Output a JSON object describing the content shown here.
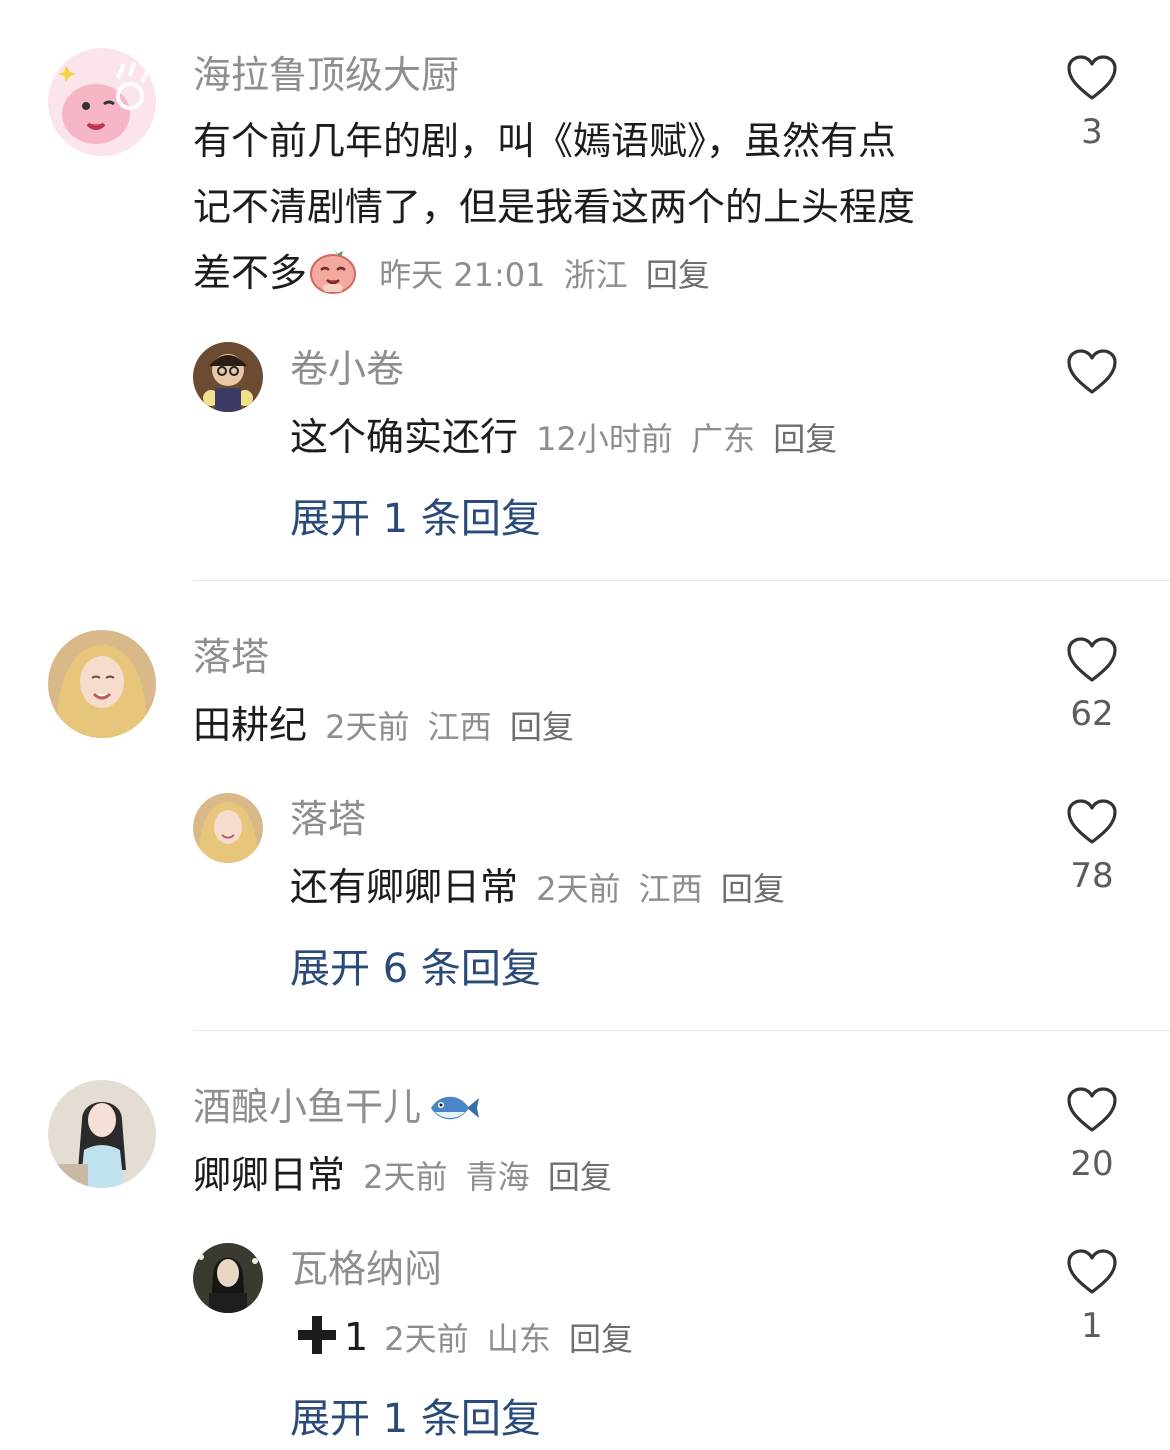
{
  "comments": [
    {
      "user": "海拉鲁顶级大厨",
      "text_line1": "有个前几年的剧，叫《嫣语赋》，虽然有点",
      "text_line2": "记不清剧情了，但是我看这两个的上头程度",
      "text_line3": "差不多",
      "time": "昨天 21:01",
      "location": "浙江",
      "reply_label": "回复",
      "likes": "3",
      "replies": [
        {
          "user": "卷小卷",
          "text": "这个确实还行",
          "time": "12小时前",
          "location": "广东",
          "reply_label": "回复"
        }
      ],
      "expand_label": "展开 1 条回复"
    },
    {
      "user": "落塔",
      "text": "田耕纪",
      "time": "2天前",
      "location": "江西",
      "reply_label": "回复",
      "likes": "62",
      "replies": [
        {
          "user": "落塔",
          "text": "还有卿卿日常",
          "time": "2天前",
          "location": "江西",
          "reply_label": "回复",
          "likes": "78"
        }
      ],
      "expand_label": "展开 6 条回复"
    },
    {
      "user": "酒酿小鱼干儿",
      "text": "卿卿日常",
      "time": "2天前",
      "location": "青海",
      "reply_label": "回复",
      "likes": "20",
      "replies": [
        {
          "user": "瓦格纳闷",
          "text": "1",
          "time": "2天前",
          "location": "山东",
          "reply_label": "回复",
          "likes": "1"
        }
      ],
      "expand_label": "展开 1 条回复"
    }
  ],
  "colors": {
    "username": "#8e8e8e",
    "expand_link": "#2a4a7a",
    "divider": "#e6e6e6"
  },
  "icons": {
    "like": "heart-outline-icon",
    "plus": "plus-icon",
    "fish": "fish-emoji-icon",
    "emoji": "blush-emoji-icon"
  }
}
